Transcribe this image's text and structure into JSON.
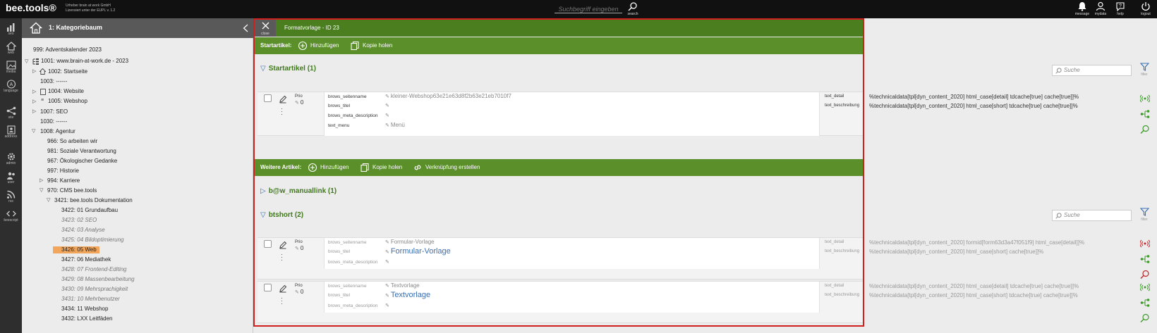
{
  "topbar": {
    "brand": "bee.tools®",
    "brand_sub1": "Urheber brain at work GmbH",
    "brand_sub2": "Lizensiert unter der EUPL v. 1.2",
    "search_placeholder": "Suchbegriff eingeben",
    "search_label": "search",
    "icons": [
      {
        "label": "message",
        "icon": "bell-icon"
      },
      {
        "label": "mydata",
        "icon": "user-icon"
      },
      {
        "label": "help",
        "icon": "help-icon"
      },
      {
        "label": "logout",
        "icon": "power-icon"
      }
    ]
  },
  "rail": [
    {
      "label": "seo",
      "icon": "bar-chart-icon"
    },
    {
      "label": "web",
      "icon": "home-icon"
    },
    {
      "label": "media",
      "icon": "image-icon"
    },
    {
      "label": "language",
      "icon": "translate-icon"
    },
    {
      "label": "site",
      "icon": "sitemap-icon"
    },
    {
      "label": "address",
      "icon": "contact-icon"
    },
    {
      "label": "admin",
      "icon": "gear-icon"
    },
    {
      "label": "user",
      "icon": "users-icon"
    },
    {
      "label": "rss",
      "icon": "rss-icon"
    },
    {
      "label": "beescript",
      "icon": "code-icon"
    }
  ],
  "tree": {
    "title": "1: Kategoriebaum",
    "nodes": [
      {
        "label": "999: Adventskalender 2023"
      },
      {
        "label": "1001: www.brain-at-work.de - 2023"
      },
      {
        "label": "1002: Startseite"
      },
      {
        "label": "1003: ------"
      },
      {
        "label": "1004: Website"
      },
      {
        "label": "1005: Webshop"
      },
      {
        "label": "1007: SEO"
      },
      {
        "label": "1030: ------"
      },
      {
        "label": "1008: Agentur"
      },
      {
        "label": "966: So arbeiten wir"
      },
      {
        "label": "981: Soziale Verantwortung"
      },
      {
        "label": "967: Ökologischer Gedanke"
      },
      {
        "label": "997: Historie"
      },
      {
        "label": "994: Karriere"
      },
      {
        "label": "970: CMS bee.tools"
      },
      {
        "label": "3421: bee.tools Dokumentation"
      },
      {
        "label": "3422: 01 Grundaufbau"
      },
      {
        "label": "3423: 02 SEO"
      },
      {
        "label": "3424: 03 Analyse"
      },
      {
        "label": "3425: 04 Bildoptimierung"
      },
      {
        "label": "3426: 05 Web"
      },
      {
        "label": "3427: 06 Mediathek"
      },
      {
        "label": "3428: 07 Frontend-Editing"
      },
      {
        "label": "3429: 08 Massenbearbeitung"
      },
      {
        "label": "3430: 09 Mehrsprachigkeit"
      },
      {
        "label": "3431: 10 Mehrbenutzer"
      },
      {
        "label": "3434: 11 Webshop"
      },
      {
        "label": "3432: LXX Leitfäden"
      }
    ]
  },
  "main": {
    "close_label": "close",
    "header_title": "Formatvorlage - ID 23",
    "start_bar": {
      "label": "Startartikel:",
      "add": "Hinzufügen",
      "copy": "Kopie holen"
    },
    "section_start": "Startartikel (1)",
    "search_placeholder": "Suche",
    "filter_label": "filter",
    "prio_label": "Prio",
    "start_card": {
      "prio": "0",
      "fields": [
        {
          "name": "brows_seitenname",
          "value": "kleiner-Webshop63e21e63d8f2b63e21eb7010f7"
        },
        {
          "name": "brows_titel",
          "value": ""
        },
        {
          "name": "brows_meta_description",
          "value": ""
        },
        {
          "name": "text_menu",
          "value": "Menü"
        }
      ],
      "right": [
        {
          "name": "text_detail",
          "value": "%technicaldata[tpl[dyn_content_2020] html_case[detail] tdcache[true] cache[true]]%"
        },
        {
          "name": "text_beschreibung",
          "value": "%technicaldata[tpl[dyn_content_2020] html_case[short] tdcache[true] cache[true]]%"
        }
      ]
    },
    "further_bar": {
      "label": "Weitere Artikel:",
      "add": "Hinzufügen",
      "copy": "Kopie holen",
      "link": "Verknüpfung erstellen"
    },
    "section_manual": "b@w_manuallink (1)",
    "section_btshort": "btshort (2)",
    "btshort_cards": [
      {
        "prio": "0",
        "fields": [
          {
            "name": "brows_seitenname",
            "value": "Formular-Vorlage"
          },
          {
            "name": "brows_titel",
            "value": "Formular-Vorlage"
          },
          {
            "name": "brows_meta_description",
            "value": ""
          }
        ],
        "right": [
          {
            "name": "text_detail",
            "value": "%technicaldata[tpl[dyn_content_2020] formid[form63d3a47f051f9] html_case[detail]]%"
          },
          {
            "name": "text_beschreibung",
            "value": "%technicaldata[tpl[dyn_content_2020] html_case[short] cache[true]]%"
          }
        ]
      },
      {
        "prio": "0",
        "fields": [
          {
            "name": "brows_seitenname",
            "value": "Textvorlage"
          },
          {
            "name": "brows_titel",
            "value": "Textvorlage"
          },
          {
            "name": "brows_meta_description",
            "value": ""
          }
        ],
        "right": [
          {
            "name": "text_detail",
            "value": "%technicaldata[tpl[dyn_content_2020] html_case[detail] tdcache[true] cache[true]]%"
          },
          {
            "name": "text_beschreibung",
            "value": "%technicaldata[tpl[dyn_content_2020] html_case[short] tdcache[true] cache[true]]%"
          }
        ]
      }
    ]
  },
  "colors": {
    "accent_green": "#5a8f2a",
    "header_green": "#4a7e1e",
    "frame_red": "#d01f1f",
    "selected": "#f2a65c",
    "link_blue": "#3a6fb0"
  }
}
